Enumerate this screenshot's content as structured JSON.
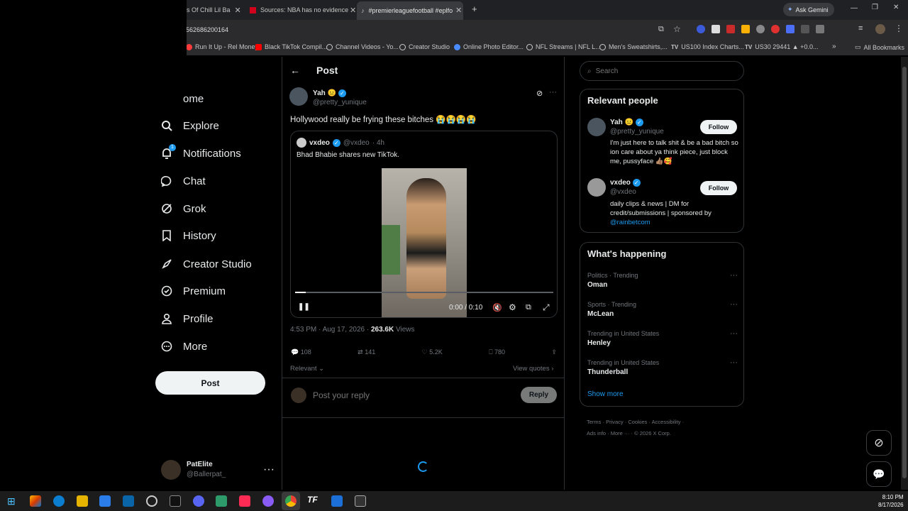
{
  "browser": {
    "tabs": [
      {
        "label": "s Of Chill Lil Ba"
      },
      {
        "label": "Sources: NBA has no evidence"
      },
      {
        "label": "#premierleaguefootball #eplfo"
      }
    ],
    "ask_gemini": "Ask Gemini",
    "url": "562686200164",
    "bookmarks": [
      {
        "label": "Run It Up - Rel Money",
        "color": "#ff3b3b"
      },
      {
        "label": "Black TikTok Compil...",
        "color": "#ff0000"
      },
      {
        "label": "Channel Videos - Yo...",
        "color": "#cccccc"
      },
      {
        "label": "Creator Studio",
        "color": "#cccccc"
      },
      {
        "label": "Online Photo Editor...",
        "color": "#4a8cff"
      },
      {
        "label": "NFL Streams | NFL L...",
        "color": "#cccccc"
      },
      {
        "label": "Men's Sweatshirts,...",
        "color": "#cccccc"
      },
      {
        "label": "US100 Index Charts...",
        "color": "#ffffff"
      },
      {
        "label": "US30 29441 ▲ +0.0...",
        "color": "#ffffff"
      }
    ],
    "all_bookmarks": "All Bookmarks"
  },
  "nav": {
    "items": [
      {
        "label": "Home",
        "icon": "home-icon"
      },
      {
        "label": "Explore",
        "icon": "search-icon"
      },
      {
        "label": "Notifications",
        "icon": "bell-icon"
      },
      {
        "label": "Chat",
        "icon": "chat-icon"
      },
      {
        "label": "Grok",
        "icon": "grok-icon"
      },
      {
        "label": "History",
        "icon": "bookmark-icon"
      },
      {
        "label": "Creator Studio",
        "icon": "rocket-icon"
      },
      {
        "label": "Premium",
        "icon": "verified-icon"
      },
      {
        "label": "Profile",
        "icon": "person-icon"
      },
      {
        "label": "More",
        "icon": "more-circle-icon"
      }
    ],
    "home_visible": "ome",
    "notif_badge": "1",
    "post_button": "Post",
    "account": {
      "name": "PatElite",
      "handle": "@Ballerpat_"
    }
  },
  "post": {
    "header": "Post",
    "author": {
      "name": "Yah",
      "handle": "@pretty_yunique"
    },
    "text": "Hollywood really be frying these bitches",
    "emojis": "😭😭😭😭",
    "quote": {
      "name": "vxdeo",
      "handle": "@vxdeo",
      "time": "· 4h",
      "text": "Bhad Bhabie shares new TikTok."
    },
    "video_time": "0:00 / 0:10",
    "video_progress": 0.04,
    "meta": {
      "time": "4:53 PM · Aug 17, 2026 ·",
      "views": "263.6K",
      "views_label": "Views"
    },
    "actions": {
      "replies": "108",
      "reposts": "141",
      "likes": "5.2K",
      "bookmarks": "780"
    },
    "relevant": "Relevant",
    "view_quotes": "View quotes",
    "reply_placeholder": "Post your reply",
    "reply_button": "Reply"
  },
  "sidebar": {
    "search_placeholder": "Search",
    "relevant_title": "Relevant people",
    "people": [
      {
        "name": "Yah",
        "handle": "@pretty_yunique",
        "bio": "I'm just here to talk shit & be a bad bitch so ion care about ya think piece, just block me, pussyface 👍🏽🥰",
        "follow": "Follow"
      },
      {
        "name": "vxdeo",
        "handle": "@vxdeo",
        "bio": "daily clips & news | DM for credit/submissions | sponsored by",
        "link": "@rainbetcom",
        "follow": "Follow"
      }
    ],
    "happening_title": "What's happening",
    "trends": [
      {
        "context": "Politics · Trending",
        "name": "Oman"
      },
      {
        "context": "Sports · Trending",
        "name": "McLean"
      },
      {
        "context": "Trending in United States",
        "name": "Henley"
      },
      {
        "context": "Trending in United States",
        "name": "Thunderball"
      }
    ],
    "show_more": "Show more",
    "footer1": "Terms · Privacy · Cookies · Accessibility ·",
    "footer2": "Ads info · More ··· · © 2026 X Corp."
  },
  "taskbar": {
    "time": "8:10 PM",
    "date": "8/17/2026"
  }
}
